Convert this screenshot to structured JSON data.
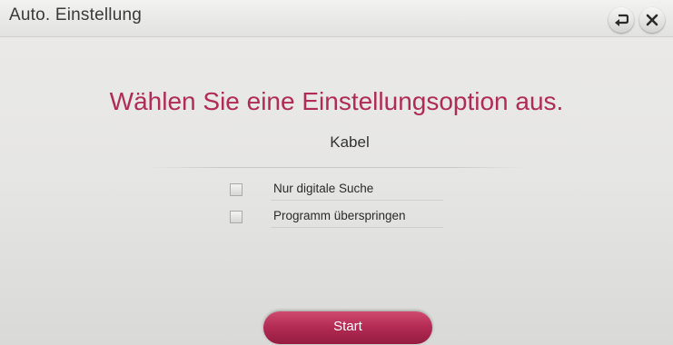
{
  "window": {
    "title": "Auto. Einstellung",
    "back_icon": "back-arrow-icon",
    "close_icon": "close-icon"
  },
  "main": {
    "heading": "Wählen Sie eine Einstellungsoption aus.",
    "subheading": "Kabel",
    "options": [
      {
        "label": "Nur digitale Suche",
        "checked": false
      },
      {
        "label": "Programm überspringen",
        "checked": false
      }
    ],
    "start_label": "Start"
  },
  "colors": {
    "accent": "#b02c57",
    "button": "#b22a52"
  }
}
